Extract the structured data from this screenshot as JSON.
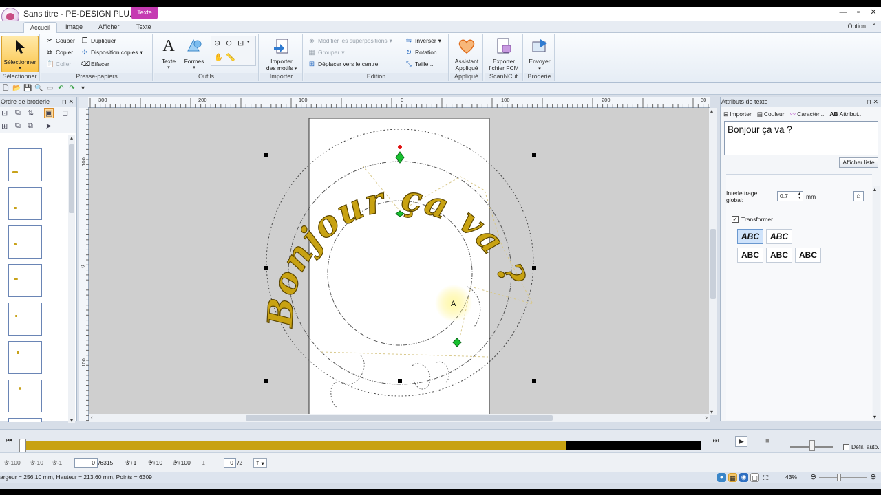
{
  "window": {
    "title": "Sans titre - PE-DESIGN PLU...",
    "context_tab": "Texte",
    "controls": {
      "minimize": "—",
      "maximize": "▫",
      "close": "✕"
    }
  },
  "ribbon_tabs": [
    "Accueil",
    "Image",
    "Afficher",
    "Texte"
  ],
  "option_label": "Option",
  "groups": {
    "selectionner": {
      "label": "Sélectionner",
      "select_button": "Sélectionner"
    },
    "presse_papiers": {
      "label": "Presse-papiers",
      "couper": "Couper",
      "copier": "Copier",
      "coller": "Coller",
      "dupliquer": "Dupliquer",
      "disposition": "Disposition copies",
      "effacer": "Effacer"
    },
    "outils": {
      "label": "Outils",
      "texte": "Texte",
      "formes": "Formes"
    },
    "importer": {
      "label": "Importer",
      "importer_motifs_1": "Importer",
      "importer_motifs_2": "des motifs"
    },
    "edition": {
      "label": "Edition",
      "modifier": "Modifier les superpositions",
      "grouper": "Grouper",
      "deplacer": "Déplacer vers le centre",
      "inverser": "Inverser",
      "rotation": "Rotation...",
      "taille": "Taille..."
    },
    "applique": {
      "label": "Appliqué",
      "assistant_1": "Assistant",
      "assistant_2": "Appliqué"
    },
    "scanncut": {
      "label": "ScanNCut",
      "exporter_1": "Exporter",
      "exporter_2": "fichier FCM"
    },
    "broderie": {
      "label": "Broderie",
      "envoyer": "Envoyer"
    }
  },
  "left_panel": {
    "title": "Ordre de broderie",
    "pin": "⊓",
    "close": "✕"
  },
  "rulers": {
    "h_labels": [
      "300",
      "200",
      "100",
      "0",
      "100",
      "200",
      "30"
    ],
    "v_labels": [
      "100",
      "0",
      "100"
    ]
  },
  "canvas": {
    "embroidery_text": "Bonjour ça va ?",
    "cursor_label": "A"
  },
  "right_panel": {
    "title": "Attributs de texte",
    "tabs": [
      "Importer",
      "Couleur",
      "Caractèr...",
      "Attribut..."
    ],
    "text_value": "Bonjour ça va ?",
    "show_list": "Afficher liste",
    "spacing_label_1": "Interlettrage",
    "spacing_label_2": "global:",
    "spacing_value": "0.7",
    "spacing_unit": "mm",
    "transform_label": "Transformer",
    "transform_checked": true,
    "shape_labels": [
      "ABC",
      "ABC",
      "ABC",
      "ABC",
      "ABC"
    ]
  },
  "playback": {
    "progress_fraction": 0.8,
    "auto_scroll_label": "Défil. auto."
  },
  "nav": {
    "minus100": "-100",
    "minus10": "-10",
    "minus1": "-1",
    "stitch_value": "0",
    "stitch_total": "/6315",
    "plus1": "+1",
    "plus10": "+10",
    "plus100": "+100",
    "color_value": "0",
    "color_total": "/2"
  },
  "status": {
    "text": "argeur = 256.10 mm, Hauteur = 213.60 mm, Points = 6309",
    "zoom": "43%"
  },
  "colors": {
    "thread_gold": "#c8a212",
    "select_orange": "#fbc54a",
    "ribbon_bg": "#e6edf5"
  }
}
